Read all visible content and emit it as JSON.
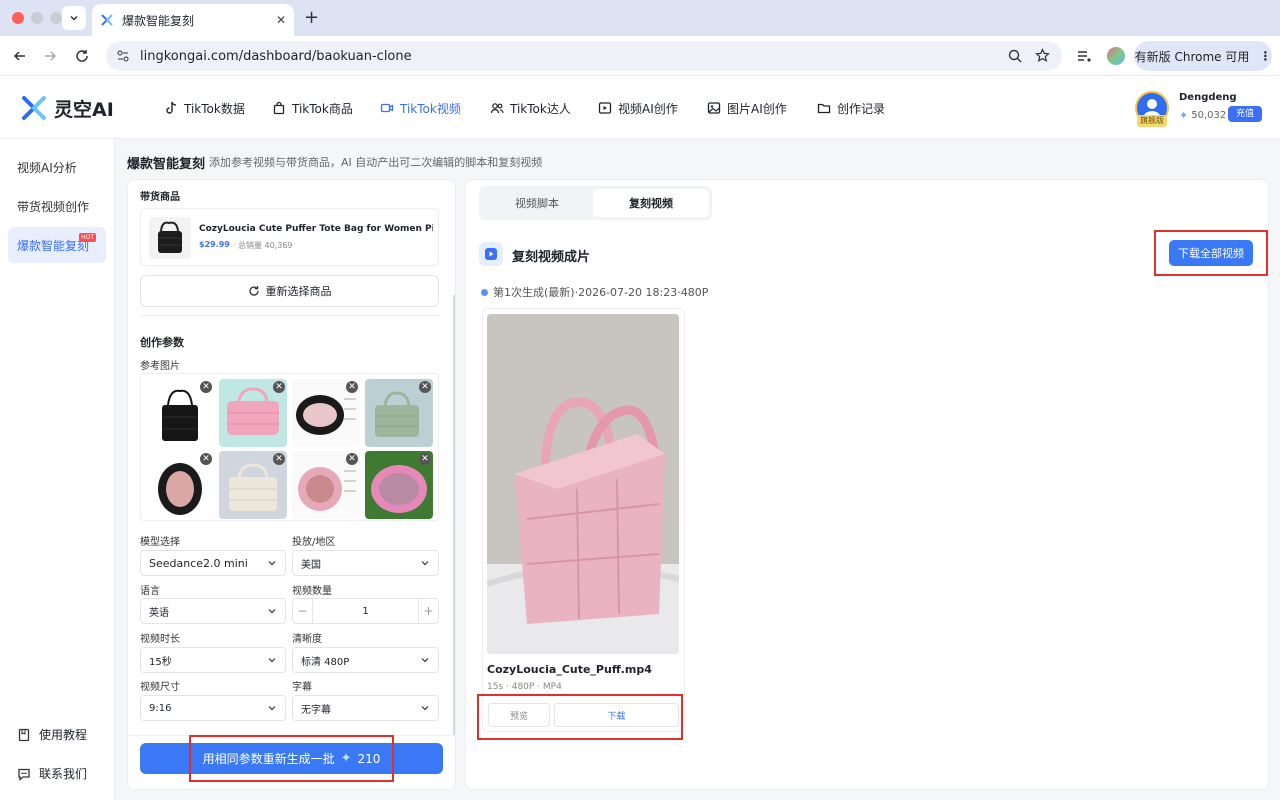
{
  "browser": {
    "tab_title": "爆款智能复刻",
    "url": "lingkongai.com/dashboard/baokuan-clone",
    "update_label": "有新版 Chrome 可用"
  },
  "header": {
    "logo_text": "灵空AI",
    "nav": [
      {
        "label": "TikTok数据",
        "icon": "tiktok-icon"
      },
      {
        "label": "TikTok商品",
        "icon": "shopping-bag-icon"
      },
      {
        "label": "TikTok视频",
        "icon": "video-camera-icon"
      },
      {
        "label": "TikTok达人",
        "icon": "users-icon"
      },
      {
        "label": "视频AI创作",
        "icon": "video-ai-icon"
      },
      {
        "label": "图片AI创作",
        "icon": "image-icon"
      },
      {
        "label": "创作记录",
        "icon": "folder-icon"
      }
    ],
    "user": {
      "name": "Dengdeng",
      "badge": "旗舰版",
      "credits": "50,032",
      "recharge": "充值"
    }
  },
  "sidebar": {
    "items": [
      {
        "label": "视频AI分析"
      },
      {
        "label": "带货视频创作"
      },
      {
        "label": "爆款智能复刻",
        "badge": "HOT"
      }
    ],
    "bottom": [
      {
        "label": "使用教程",
        "icon": "book-icon"
      },
      {
        "label": "联系我们",
        "icon": "chat-icon"
      }
    ]
  },
  "page": {
    "title": "爆款智能复刻",
    "subtitle": "添加参考视频与带货商品，AI 自动产出可二次编辑的脚本和复刻视频"
  },
  "left": {
    "product_section": "带货商品",
    "product": {
      "name": "CozyLoucia Cute Puffer Tote Bag for Women Pink...",
      "price": "$29.99",
      "sales": "· 总销量 40,369"
    },
    "reselect_label": "重新选择商品",
    "params_title": "创作参数",
    "ref_images_label": "参考图片",
    "fields": {
      "model": {
        "label": "模型选择",
        "value": "Seedance2.0 mini"
      },
      "region": {
        "label": "投放/地区",
        "value": "美国"
      },
      "language": {
        "label": "语言",
        "value": "英语"
      },
      "count": {
        "label": "视频数量",
        "value": "1",
        "minus": "−",
        "plus": "+"
      },
      "duration": {
        "label": "视频时长",
        "value": "15秒"
      },
      "resolution": {
        "label": "清晰度",
        "value": "标清 480P"
      },
      "size": {
        "label": "视频尺寸",
        "value": "9:16"
      },
      "subtitle": {
        "label": "字幕",
        "value": "无字幕"
      }
    },
    "generate_label": "用相同参数重新生成一批",
    "generate_cost": "210"
  },
  "right": {
    "tabs": [
      {
        "label": "视频脚本"
      },
      {
        "label": "复刻视频"
      }
    ],
    "result_title": "复刻视频成片",
    "download_all": "下载全部视频",
    "generation_info": "第1次生成(最新)·2026-07-20 18:23·480P",
    "video": {
      "filename": "CozyLoucia_Cute_Puff.mp4",
      "meta": "15s · 480P · MP4",
      "preview": "预览",
      "download": "下载"
    }
  },
  "colors": {
    "accent": "#3a6ff6",
    "highlight": "#e0302a"
  }
}
